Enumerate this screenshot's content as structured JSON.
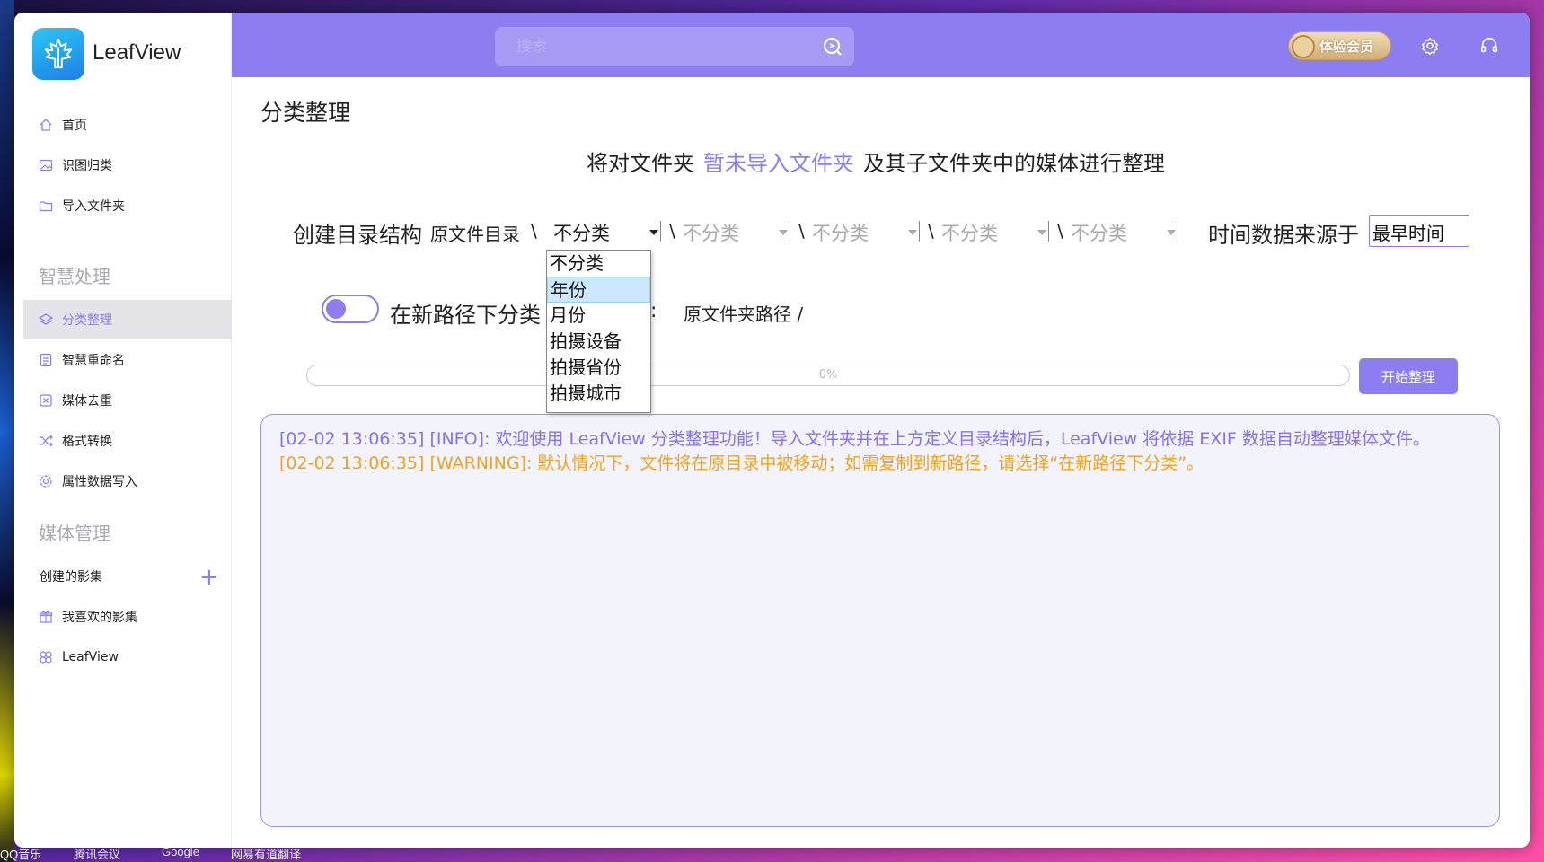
{
  "app": {
    "name": "LeafView"
  },
  "sidebar": {
    "top_items": [
      {
        "label": "首页",
        "icon": "home-icon"
      },
      {
        "label": "识图归类",
        "icon": "image-icon"
      },
      {
        "label": "导入文件夹",
        "icon": "folder-icon"
      }
    ],
    "section_smart": "智慧处理",
    "smart_items": [
      {
        "label": "分类整理",
        "icon": "layers-icon",
        "active": true
      },
      {
        "label": "智慧重命名",
        "icon": "rename-icon"
      },
      {
        "label": "媒体去重",
        "icon": "dedupe-icon"
      },
      {
        "label": "格式转换",
        "icon": "shuffle-icon"
      },
      {
        "label": "属性数据写入",
        "icon": "gear-flower-icon"
      }
    ],
    "section_media": "媒体管理",
    "created_albums": "创建的影集",
    "add_symbol": "+",
    "media_items": [
      {
        "label": "我喜欢的影集",
        "icon": "gift-icon"
      },
      {
        "label": "LeafView",
        "icon": "flower-icon"
      }
    ]
  },
  "topbar": {
    "search_placeholder": "搜索",
    "vip_label": "体验会员"
  },
  "main": {
    "title": "分类整理",
    "info_prefix": "将对文件夹",
    "info_folder": "暂未导入文件夹",
    "info_suffix": "及其子文件夹中的媒体进行整理",
    "structure_label": "创建目录结构",
    "root_label": "原文件目录",
    "separator": "\\",
    "levels": [
      "不分类",
      "不分类",
      "不分类",
      "不分类",
      "不分类"
    ],
    "time_source_label": "时间数据来源于",
    "time_source_value": "最早时间",
    "dropdown_options": [
      "不分类",
      "年份",
      "月份",
      "拍摄设备",
      "拍摄省份",
      "拍摄城市"
    ],
    "dropdown_highlighted": "年份",
    "toggle_on": false,
    "new_path_label": "在新路径下分类",
    "path_colon": ":",
    "path_value": "原文件夹路径  /",
    "progress_percent": 0,
    "progress_text": "0%",
    "start_button": "开始整理"
  },
  "log": [
    {
      "level": "info",
      "text": "[02-02 13:06:35] [INFO]: 欢迎使用 LeafView 分类整理功能！导入文件夹并在上方定义目录结构后，LeafView 将依据 EXIF 数据自动整理媒体文件。"
    },
    {
      "level": "warn",
      "text": "[02-02 13:06:35] [WARNING]: 默认情况下，文件将在原目录中被移动；如需复制到新路径，请选择“在新路径下分类”。"
    }
  ],
  "taskbar": [
    "QQ音乐",
    "腾讯会议",
    "Google",
    "网易有道翻译"
  ],
  "colors": {
    "accent": "#8c7ef0",
    "info": "#8a6ff2",
    "warning": "#f2a21e"
  }
}
